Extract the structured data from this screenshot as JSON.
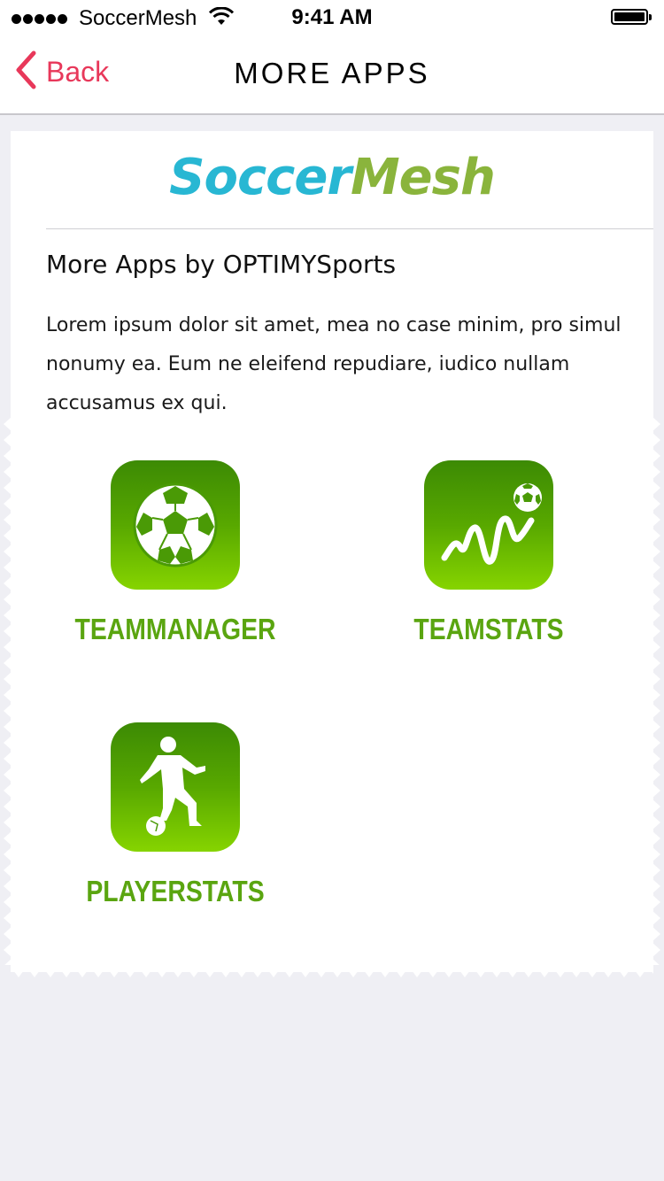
{
  "status_bar": {
    "carrier": "SoccerMesh",
    "time": "9:41 AM"
  },
  "nav": {
    "back_label": "Back",
    "title": "MORE APPS"
  },
  "logo": {
    "part1": "Soccer",
    "part2": "Mesh"
  },
  "section": {
    "title": "More Apps by OPTIMYSports",
    "body": "Lorem ipsum dolor sit amet, mea no case minim, pro simul nonumy ea. Eum ne eleifend repudiare, iudico nullam accusamus ex qui."
  },
  "apps": [
    {
      "name": "TEAMMANAGER",
      "icon": "soccer-ball-icon"
    },
    {
      "name": "TEAMSTATS",
      "icon": "stats-wave-icon"
    },
    {
      "name": "PLAYERSTATS",
      "icon": "player-icon"
    }
  ],
  "colors": {
    "back_accent": "#e8385a",
    "logo_blue": "#28b7d3",
    "logo_green": "#8ab43c",
    "app_label_green": "#5aa510"
  }
}
